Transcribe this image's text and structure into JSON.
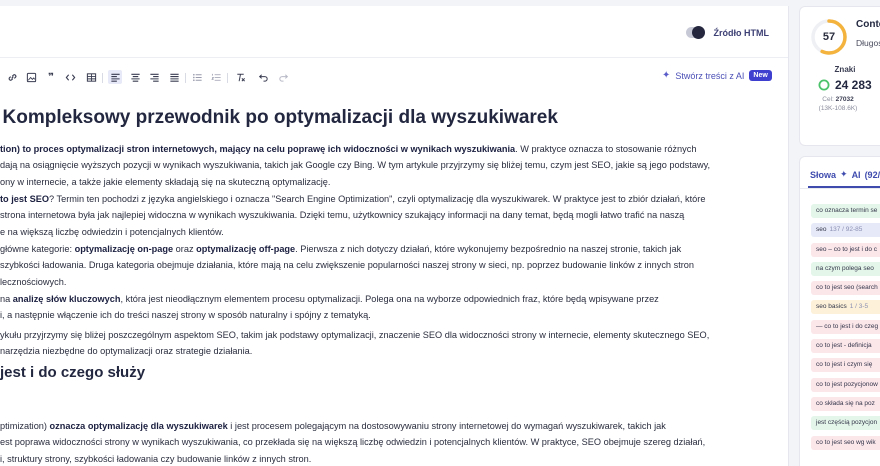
{
  "header": {
    "source_html_label": "Źródło HTML"
  },
  "toolbar": {
    "ai_create_label": "Stwórz treści z AI",
    "new_badge": "New"
  },
  "article": {
    "h1": "/ Kompleksowy przewodnik po optymalizacji dla wyszukiwarek",
    "p1": {
      "bold_lead": "tion) to proces optymalizacji stron internetowych, mający na celu poprawę ich widoczności w wynikach wyszukiwania",
      "rest_line1": ". W praktyce oznacza to stosowanie różnych",
      "line2": "dają na osiągnięcie wyższych pozycji w wynikach wyszukiwania, takich jak Google czy Bing. W tym artykule przyjrzymy się bliżej temu, czym jest SEO, jakie są jego podstawy,",
      "line3": "ony w internecie, a także jakie elementy składają się na skuteczną optymalizację."
    },
    "p2": {
      "bold_lead": "to jest SEO",
      "rest_line1": "? Termin ten pochodzi z języka angielskiego i oznacza \"Search Engine Optimization\", czyli optymalizację dla wyszukiwarek. W praktyce jest to zbiór działań, które",
      "line2": " strona internetowa była jak najlepiej widoczna w wynikach wyszukiwania. Dzięki temu, użytkownicy szukający informacji na dany temat, będą mogli łatwo trafić na naszą",
      "line3": "e na większą liczbę odwiedzin i potencjalnych klientów."
    },
    "p3": {
      "lead": " główne kategorie: ",
      "bold1": "optymalizację on-page",
      "mid": " oraz ",
      "bold2": "optymalizację off-page",
      "rest_line1": ". Pierwsza z nich dotyczy działań, które wykonujemy bezpośrednio na naszej stronie, takich jak",
      "line2": "szybkości ładowania. Druga kategoria obejmuje działania, które mają na celu zwiększenie popularności naszej strony w sieci, np. poprzez budowanie linków z innych stron",
      "line3": "lecznościowych."
    },
    "p4": {
      "lead": " na ",
      "bold1": "analizę słów kluczowych",
      "rest_line1": ", która jest nieodłącznym elementem procesu optymalizacji. Polega ona na wyborze odpowiednich fraz, które będą wpisywane przez",
      "line2": "i, a następnie włączenie ich do treści naszej strony w sposób naturalny i spójny z tematyką."
    },
    "p5": {
      "line1": "ykułu przyjrzymy się bliżej poszczególnym aspektom SEO, takim jak podstawy optymalizacji, znaczenie SEO dla widoczności strony w internecie, elementy skutecznego SEO,",
      "line2": "narzędzia niezbędne do optymalizacji oraz strategie działania."
    },
    "h2": "jest i do czego służy",
    "p6": {
      "lead": "ptimization) ",
      "bold1": "oznacza optymalizację dla wyszukiwarek",
      "rest_line1": " i jest procesem polegającym na dostosowywaniu strony internetowej do wymagań wyszukiwarek, takich jak",
      "line2": "est poprawa widoczności strony w wynikach wyszukiwania, co przekłada się na większą liczbę odwiedzin i potencjalnych klientów. W praktyce, SEO obejmuje szereg działań,",
      "line3": "i, struktury strony, szybkości ładowania czy budowanie linków z innych stron."
    }
  },
  "sidebar": {
    "score": "57",
    "score_fraction": 0.57,
    "content_title": "Conte",
    "dlugosc": "Długoś",
    "znaki_label": "Znaki",
    "znaki_count": "24 283",
    "cel_prefix": "Cel: ",
    "cel_value": "27032",
    "range": "(13K-108.6K)",
    "keywords_tab": "Słowa",
    "ai_label": "AI",
    "ai_count": "(92/2",
    "keywords": [
      {
        "text": "co oznacza termin se",
        "status": "green",
        "count": ""
      },
      {
        "text": "seo",
        "status": "blue",
        "count": "137 / 92-85"
      },
      {
        "text": "seo – co to jest i do c",
        "status": "red",
        "count": ""
      },
      {
        "text": "na czym polega seo",
        "status": "green",
        "count": ""
      },
      {
        "text": "co to jest seo (search",
        "status": "red",
        "count": ""
      },
      {
        "text": "seo basics",
        "status": "yellow",
        "count": "1 / 3-5"
      },
      {
        "text": "— co to jest i do czeg",
        "status": "red",
        "count": ""
      },
      {
        "text": "co to jest - definicja",
        "status": "red",
        "count": ""
      },
      {
        "text": "co to jest i czym się",
        "status": "red",
        "count": ""
      },
      {
        "text": "co to jest pozycjonow",
        "status": "red",
        "count": ""
      },
      {
        "text": "co składa się na poz",
        "status": "red",
        "count": ""
      },
      {
        "text": "jest częścią pozycjon",
        "status": "green",
        "count": ""
      },
      {
        "text": "co to jest seo wg wik",
        "status": "red",
        "count": ""
      }
    ]
  },
  "colors": {
    "accent": "#3f4cae",
    "ring_green": "#4cc36b",
    "ring_orange": "#f3b33d"
  }
}
